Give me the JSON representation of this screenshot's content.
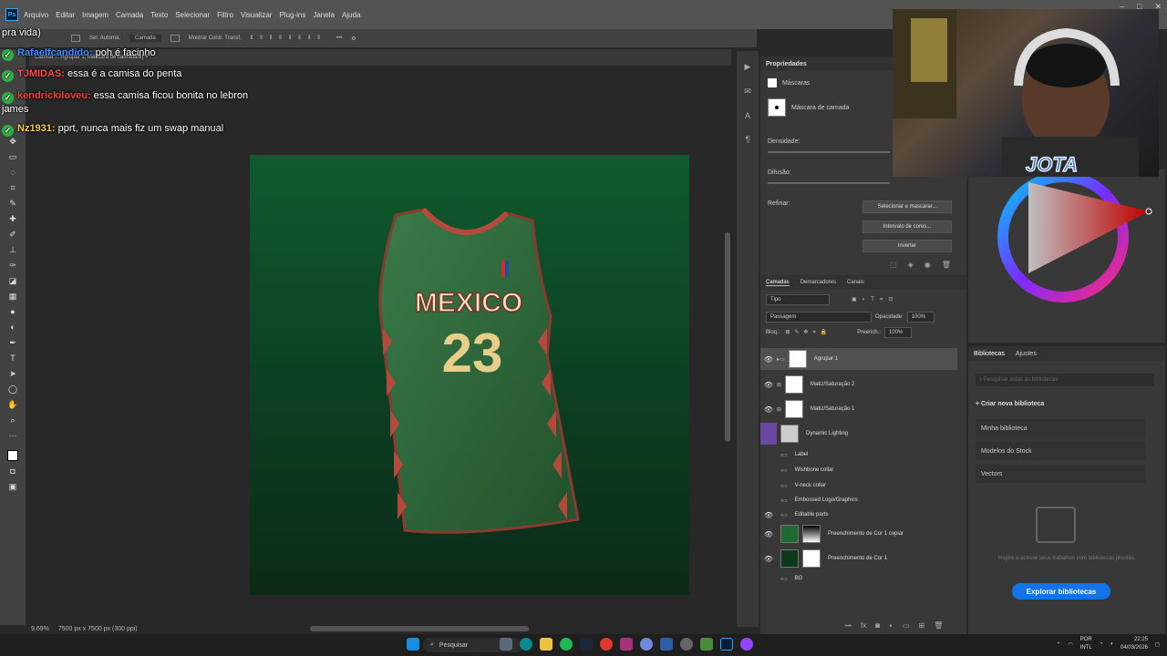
{
  "menubar": {
    "logo": "Ps",
    "items": [
      "Arquivo",
      "Editar",
      "Imagem",
      "Camada",
      "Texto",
      "Selecionar",
      "Filtro",
      "Visualizar",
      "Plug-ins",
      "Janela",
      "Ajuda"
    ]
  },
  "optionsbar": {
    "auto_select": "Sel. Automá.",
    "layer_dropdown": "Camada",
    "show_transform": "Mostrar Contr. Transf."
  },
  "document_tab": "Camisa ... Agrupar 1, Máscara de camada/8) ×",
  "status": {
    "zoom": "9,69%",
    "doc_size": "7500 px x 7500 px (300 ppi)"
  },
  "chat": [
    {
      "user": "",
      "text": "pra vida)",
      "user_color": "#ffffff",
      "badge": false
    },
    {
      "user": "Rafaelfcandido:",
      "text": "poh é facinho",
      "user_color": "#3f8fff",
      "badge": true
    },
    {
      "user": "TJMIDAS:",
      "text": "essa é a camisa do penta",
      "user_color": "#ff4f4f",
      "badge": true
    },
    {
      "user": "kendrickiloveu:",
      "text": "essa camisa ficou bonita no lebron",
      "user_color": "#ff3b3b",
      "badge": true
    },
    {
      "user": "",
      "text": "james",
      "user_color": "#ffffff",
      "badge": false
    },
    {
      "user": "Nz1931:",
      "text": "pprt, nunca mais fiz um swap manual",
      "user_color": "#f2c94c",
      "badge": true
    }
  ],
  "jersey": {
    "team": "MEXICO",
    "number": "23",
    "colors": {
      "body": "#2f6b3d",
      "trim": "#b44a3c",
      "text": "#f2e3c2"
    }
  },
  "properties": {
    "title": "Propriedades",
    "masks_label": "Máscaras",
    "layer_mask_label": "Máscara de camada",
    "density_label": "Densidade:",
    "feather_label": "Difusão:",
    "refine_label": "Refinar:",
    "buttons": [
      "Selecionar e mascarar...",
      "Intervalo de cores...",
      "Inverter"
    ]
  },
  "layers": {
    "tabs": [
      "Camadas",
      "Demarcadores",
      "Canais"
    ],
    "filter_kind": "Tipo",
    "blend_mode": "Passagem",
    "opacity_label": "Opacidade:",
    "opacity_value": "100%",
    "lock_label": "Bloq.:",
    "fill_label": "Preench.:",
    "fill_value": "100%",
    "items": [
      {
        "name": "Agrupar 1",
        "visible": true,
        "selected": true,
        "type": "group-mask"
      },
      {
        "name": "Matiz/Saturação 2",
        "visible": true,
        "selected": false,
        "type": "adjust"
      },
      {
        "name": "Matiz/Saturação 1",
        "visible": true,
        "selected": false,
        "type": "adjust"
      },
      {
        "name": "Dynamic Lighting",
        "visible": false,
        "selected": false,
        "type": "smart"
      },
      {
        "name": "Label",
        "visible": false,
        "selected": false,
        "type": "folder"
      },
      {
        "name": "Wishbone collar",
        "visible": false,
        "selected": false,
        "type": "folder"
      },
      {
        "name": "V-neck collar",
        "visible": false,
        "selected": false,
        "type": "folder"
      },
      {
        "name": "Embossed Logo/Graphics",
        "visible": false,
        "selected": false,
        "type": "folder"
      },
      {
        "name": "Editable parts",
        "visible": true,
        "selected": false,
        "type": "folder"
      },
      {
        "name": "Preenchimento de Cor 1 copiar",
        "visible": true,
        "selected": false,
        "type": "fill"
      },
      {
        "name": "Preenchimento de Cor 1",
        "visible": true,
        "selected": false,
        "type": "fill"
      },
      {
        "name": "BG",
        "visible": false,
        "selected": false,
        "type": "folder"
      }
    ]
  },
  "libraries": {
    "tabs": [
      "Bibliotecas",
      "Ajustes"
    ],
    "search_placeholder": "Pesquisar todas as bibliotecas",
    "create": "+ Criar nova biblioteca",
    "items": [
      "Minha biblioteca",
      "Modelos do Stock",
      "Vectors"
    ],
    "empty_text": "Inspire e acesse seus trabalhos com bibliotecas prontas.",
    "explore_button": "Explorar bibliotecas"
  },
  "webcam": {
    "watermark": "JOTA"
  },
  "taskbar": {
    "search": "Pesquisar",
    "lang_line1": "POR",
    "lang_line2": "INTL",
    "time": "22:25",
    "date": "04/03/2026"
  },
  "window_controls": [
    "–",
    "□",
    "✕"
  ]
}
